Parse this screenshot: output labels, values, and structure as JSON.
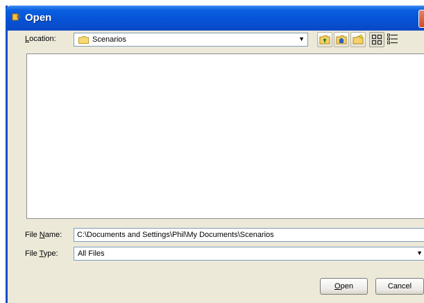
{
  "window": {
    "title": "Open"
  },
  "location": {
    "label": "Location:",
    "value": "Scenarios"
  },
  "toolbar": {
    "buttons": [
      {
        "name": "up-one-level",
        "icon": "folder-up-icon"
      },
      {
        "name": "home",
        "icon": "home-icon"
      },
      {
        "name": "new-folder",
        "icon": "new-folder-icon"
      },
      {
        "name": "list-view",
        "icon": "list-view-icon"
      },
      {
        "name": "details-view",
        "icon": "details-view-icon"
      }
    ]
  },
  "file_name": {
    "label": "File Name:",
    "value": "C:\\Documents and Settings\\Phil\\My Documents\\Scenarios"
  },
  "file_type": {
    "label": "File Type:",
    "value": "All Files"
  },
  "buttons": {
    "open": "Open",
    "cancel": "Cancel"
  },
  "colors": {
    "titlebar": "#0553d7",
    "dialog_bg": "#ece9d8",
    "field_border": "#7f9db9"
  }
}
